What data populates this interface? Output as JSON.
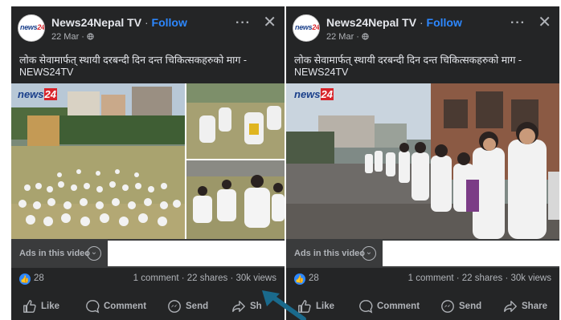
{
  "posts": [
    {
      "page_name": "News24Nepal TV",
      "separator": "·",
      "follow_label": "Follow",
      "date": "22 Mar · ",
      "logo_text_a": "news",
      "logo_text_b": "24",
      "caption": "लोक सेवामार्फत् स्थायी दरबन्दी दिन दन्त चिकित्सकहरुको माग - NEWS24TV",
      "watermark_a": "news",
      "watermark_b": "24",
      "ads_label": "Ads in this video",
      "like_count": "28",
      "stats": "1 comment · 22 shares · 30k views",
      "actions": {
        "like": "Like",
        "comment": "Comment",
        "send": "Send",
        "share": "Sh"
      }
    },
    {
      "page_name": "News24Nepal TV",
      "separator": "·",
      "follow_label": "Follow",
      "date": "22 Mar · ",
      "logo_text_a": "news",
      "logo_text_b": "24",
      "caption": "लोक सेवामार्फत् स्थायी दरबन्दी दिन दन्त चिकित्सकहरुको माग - NEWS24TV",
      "watermark_a": "news",
      "watermark_b": "24",
      "ads_label": "Ads in this video",
      "like_count": "28",
      "stats": "1 comment · 22 shares · 30k views",
      "actions": {
        "like": "Like",
        "comment": "Comment",
        "send": "Send",
        "share": "Share"
      }
    }
  ],
  "colors": {
    "panel_bg": "#242526",
    "primary_text": "#e4e6eb",
    "secondary_text": "#b0b3b8",
    "follow_blue": "#2d88ff",
    "ads_bar": "#3a3b3c",
    "arrow_annotation": "#1a6a8c"
  },
  "icons": [
    "globe-icon",
    "more-icon",
    "close-icon",
    "chevron-down-icon",
    "like-reaction-icon",
    "thumbs-up-icon",
    "comment-icon",
    "messenger-icon",
    "share-icon"
  ]
}
